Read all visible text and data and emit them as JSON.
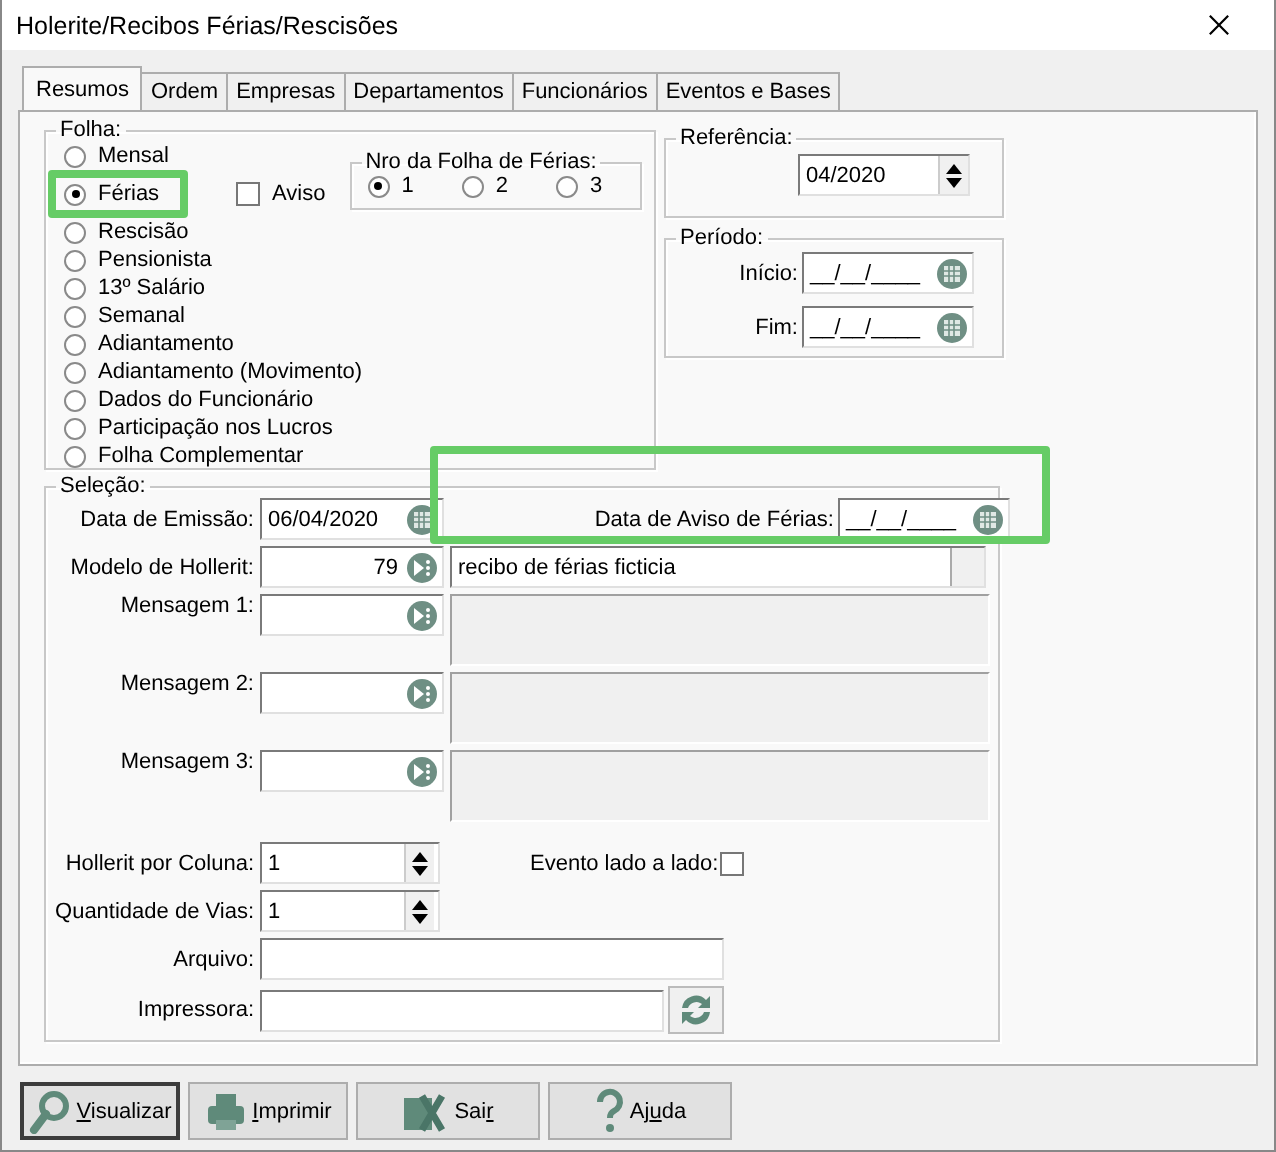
{
  "window": {
    "title": "Holerite/Recibos Férias/Rescisões"
  },
  "tabs": [
    {
      "label": "Resumos",
      "selected": true
    },
    {
      "label": "Ordem",
      "selected": false
    },
    {
      "label": "Empresas",
      "selected": false
    },
    {
      "label": "Departamentos",
      "selected": false
    },
    {
      "label": "Funcionários",
      "selected": false
    },
    {
      "label": "Eventos e Bases",
      "selected": false
    }
  ],
  "folha": {
    "legend": "Folha:",
    "options": [
      {
        "label": "Mensal",
        "selected": false
      },
      {
        "label": "Férias",
        "selected": true,
        "highlighted": true
      },
      {
        "label": "Rescisão",
        "selected": false
      },
      {
        "label": "Pensionista",
        "selected": false
      },
      {
        "label": "13º Salário",
        "selected": false
      },
      {
        "label": "Semanal",
        "selected": false
      },
      {
        "label": "Adiantamento",
        "selected": false
      },
      {
        "label": "Adiantamento (Movimento)",
        "selected": false
      },
      {
        "label": "Dados do Funcionário",
        "selected": false
      },
      {
        "label": "Participação nos Lucros",
        "selected": false
      },
      {
        "label": "Folha Complementar",
        "selected": false
      }
    ],
    "aviso": {
      "label": "Aviso",
      "checked": false
    },
    "nro_folha": {
      "legend": "Nro da Folha de Férias:",
      "options": [
        {
          "label": "1",
          "selected": true
        },
        {
          "label": "2",
          "selected": false
        },
        {
          "label": "3",
          "selected": false
        }
      ]
    }
  },
  "referencia": {
    "legend": "Referência:",
    "value": "04/2020"
  },
  "periodo": {
    "legend": "Período:",
    "fields": [
      {
        "label": "Início:",
        "value": "__/__/____"
      },
      {
        "label": "Fim:",
        "value": "__/__/____"
      }
    ]
  },
  "selecao": {
    "legend": "Seleção:",
    "data_emissao": {
      "label": "Data de Emissão:",
      "value": "06/04/2020"
    },
    "data_aviso": {
      "label": "Data de Aviso de Férias:",
      "value": "__/__/____",
      "highlighted": true
    },
    "modelo": {
      "label": "Modelo de Hollerit:",
      "value": "79",
      "description": "recibo de férias ficticia"
    },
    "mensagens": [
      {
        "label": "Mensagem 1:"
      },
      {
        "label": "Mensagem 2:"
      },
      {
        "label": "Mensagem 3:"
      }
    ],
    "hollerit_por_coluna": {
      "label": "Hollerit por Coluna:",
      "value": "1"
    },
    "evento_lado_a_lado": {
      "label": "Evento lado a lado:",
      "checked": false
    },
    "quantidade_vias": {
      "label": "Quantidade de Vias:",
      "value": "1"
    },
    "arquivo": {
      "label": "Arquivo:"
    },
    "impressora": {
      "label": "Impressora:"
    }
  },
  "buttons": [
    {
      "kind": "preview",
      "key": "V",
      "after": "isualizar",
      "selected": true
    },
    {
      "kind": "print",
      "key": "I",
      "after": "mprimir",
      "selected": false
    },
    {
      "kind": "exit",
      "before": "Sai",
      "key": "r",
      "selected": false
    },
    {
      "kind": "help",
      "before": "Aj",
      "key": "u",
      "after": "da",
      "selected": false
    }
  ]
}
